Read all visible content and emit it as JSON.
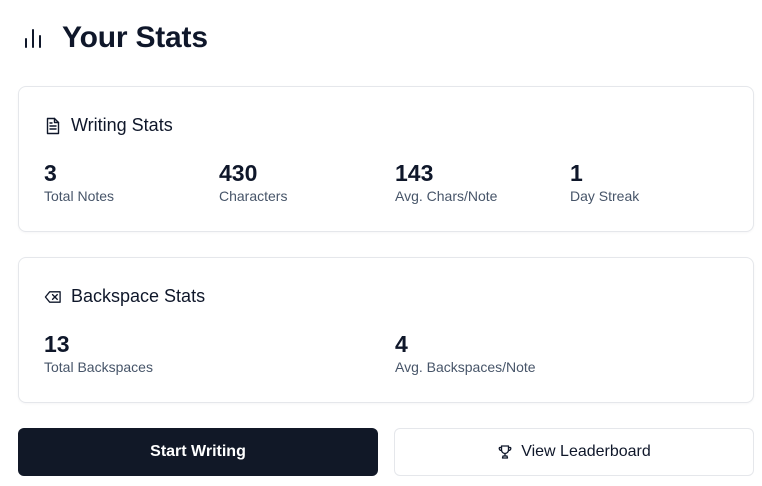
{
  "header": {
    "title": "Your Stats",
    "icon": "bar-chart-icon"
  },
  "writing_stats": {
    "title": "Writing Stats",
    "icon": "document-icon",
    "items": [
      {
        "value": "3",
        "label": "Total Notes"
      },
      {
        "value": "430",
        "label": "Characters"
      },
      {
        "value": "143",
        "label": "Avg. Chars/Note"
      },
      {
        "value": "1",
        "label": "Day Streak"
      }
    ]
  },
  "backspace_stats": {
    "title": "Backspace Stats",
    "icon": "backspace-icon",
    "items": [
      {
        "value": "13",
        "label": "Total Backspaces"
      },
      {
        "value": "4",
        "label": "Avg. Backspaces/Note"
      }
    ]
  },
  "actions": {
    "start_writing": "Start Writing",
    "view_leaderboard": "View Leaderboard",
    "leaderboard_icon": "trophy-icon"
  },
  "colors": {
    "text": "#0f172a",
    "muted": "#475569",
    "border": "#e5e7eb",
    "primary_button": "#111827"
  }
}
